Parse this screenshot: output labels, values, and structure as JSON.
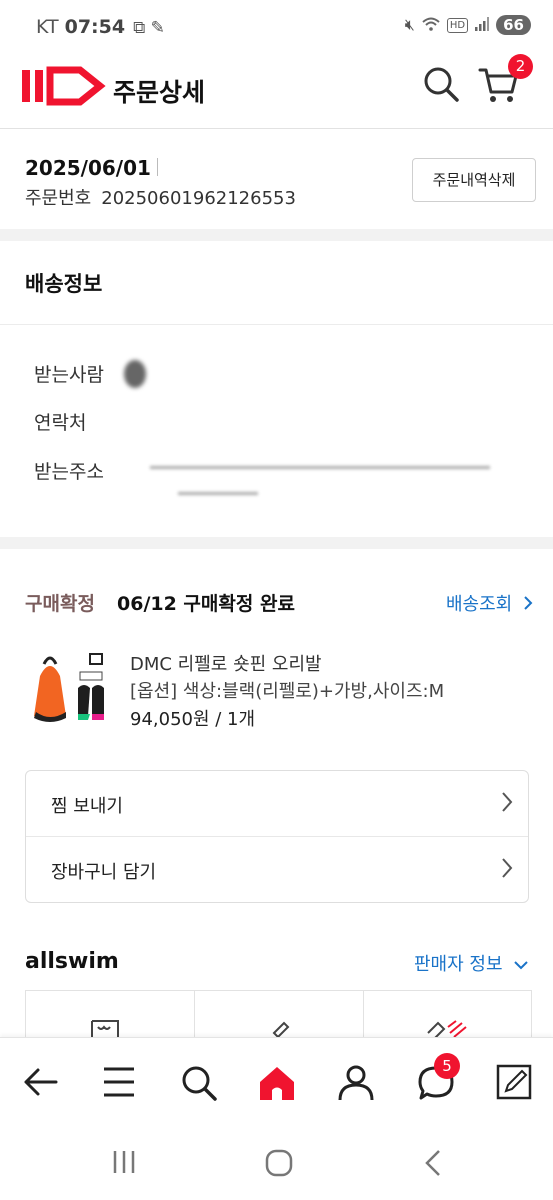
{
  "status_bar": {
    "carrier": "KT",
    "time": "07:54",
    "battery": "66"
  },
  "header": {
    "title": "주문상세",
    "cart_count": "2"
  },
  "order": {
    "date": "2025/06/01",
    "number_label": "주문번호",
    "number": "20250601962126553",
    "delete_button": "주문내역삭제"
  },
  "shipping": {
    "title": "배송정보",
    "fields": [
      {
        "label": "받는사람"
      },
      {
        "label": "연락처"
      },
      {
        "label": "받는주소"
      }
    ]
  },
  "purchase": {
    "status_label": "구매확정",
    "status_text": "06/12 구매확정 완료",
    "tracking_link": "배송조회",
    "product": {
      "name": "DMC 리펠로 숏핀 오리발",
      "option": "[옵션] 색상:블랙(리펠로)+가방,사이즈:M",
      "price_qty": "94,050원 / 1개"
    },
    "actions": [
      {
        "label": "찜 보내기"
      },
      {
        "label": "장바구니 담기"
      }
    ]
  },
  "seller": {
    "name": "allswim",
    "info_link": "판매자 정보"
  },
  "bottom_nav": {
    "items": [
      "back",
      "menu",
      "search",
      "home",
      "my",
      "chat",
      "edit"
    ],
    "chat_count": "5"
  },
  "colors": {
    "brand": "#f0142f",
    "link": "#1a73c8",
    "confirm_label": "#7a5c5c"
  }
}
